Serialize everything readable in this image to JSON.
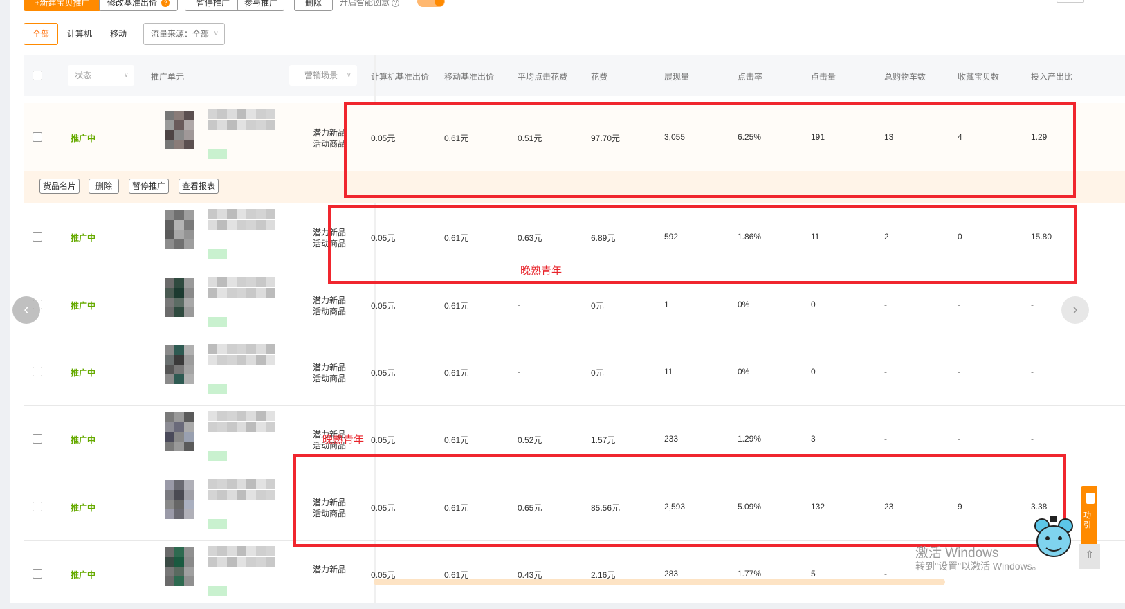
{
  "toolbar": {
    "new_plan": "+新建宝贝推广",
    "modify_bid": "修改基准出价",
    "modify_bid_badge": "?",
    "pause": "暂停推广",
    "join": "参与推广",
    "delete": "删除",
    "smart_label": "开启智能创意"
  },
  "filters": {
    "tabs": [
      "全部",
      "计算机",
      "移动"
    ],
    "active_tab": "全部",
    "source_select": "流量来源：全部"
  },
  "table": {
    "headers": {
      "status": "状态",
      "unit": "推广单元",
      "scene": "营销场景",
      "metrics": [
        "计算机基准出价",
        "移动基准出价",
        "平均点击花费",
        "花费",
        "展现量",
        "点击率",
        "点击量",
        "总购物车数",
        "收藏宝贝数",
        "投入产出比"
      ]
    },
    "row_actions": [
      "货品名片",
      "删除",
      "暂停推广",
      "查看报表"
    ],
    "rows": [
      {
        "status": "推广中",
        "scene": [
          "潜力新品",
          "活动商品"
        ],
        "values": [
          "0.05元",
          "0.61元",
          "0.51元",
          "97.70元",
          "3,055",
          "6.25%",
          "191",
          "13",
          "4",
          "1.29"
        ]
      },
      {
        "status": "推广中",
        "scene": [
          "潜力新品",
          "活动商品"
        ],
        "values": [
          "0.05元",
          "0.61元",
          "0.63元",
          "6.89元",
          "592",
          "1.86%",
          "11",
          "2",
          "0",
          "15.80"
        ]
      },
      {
        "status": "推广中",
        "scene": [
          "潜力新品",
          "活动商品"
        ],
        "values": [
          "0.05元",
          "0.61元",
          "-",
          "0元",
          "1",
          "0%",
          "0",
          "-",
          "-",
          "-"
        ]
      },
      {
        "status": "推广中",
        "scene": [
          "潜力新品",
          "活动商品"
        ],
        "values": [
          "0.05元",
          "0.61元",
          "-",
          "0元",
          "11",
          "0%",
          "0",
          "-",
          "-",
          "-"
        ]
      },
      {
        "status": "推广中",
        "scene": [
          "潜力新品",
          "活动商品"
        ],
        "values": [
          "0.05元",
          "0.61元",
          "0.52元",
          "1.57元",
          "233",
          "1.29%",
          "3",
          "-",
          "-",
          "-"
        ]
      },
      {
        "status": "推广中",
        "scene": [
          "潜力新品",
          "活动商品"
        ],
        "values": [
          "0.05元",
          "0.61元",
          "0.65元",
          "85.56元",
          "2,593",
          "5.09%",
          "132",
          "23",
          "9",
          "3.38"
        ]
      },
      {
        "status": "推广中",
        "scene": [
          "潜力新品",
          ""
        ],
        "values": [
          "0.05元",
          "0.61元",
          "0.43元",
          "2.16元",
          "283",
          "1.77%",
          "5",
          "-",
          "",
          ""
        ]
      }
    ]
  },
  "annotations": {
    "watermark_text_1": "晚熟青年",
    "watermark_text_2": "晚熟青年"
  },
  "windows": {
    "line1": "激活 Windows",
    "line2": "转到\"设置\"以激活 Windows。"
  },
  "side_widget": {
    "label_1": "功",
    "label_2": "引"
  },
  "colors": {
    "accent": "#ff8a00",
    "status_green": "#66aa00",
    "highlight_red": "#f0262e"
  }
}
